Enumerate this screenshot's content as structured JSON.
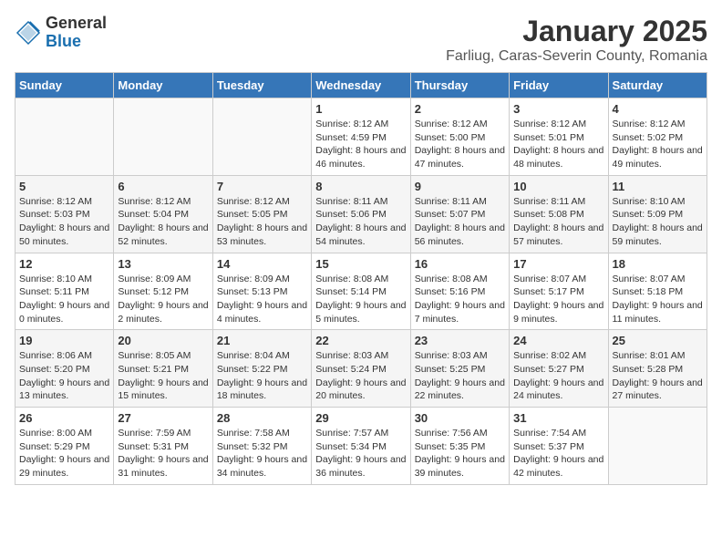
{
  "logo": {
    "general": "General",
    "blue": "Blue"
  },
  "title": "January 2025",
  "subtitle": "Farliug, Caras-Severin County, Romania",
  "days_of_week": [
    "Sunday",
    "Monday",
    "Tuesday",
    "Wednesday",
    "Thursday",
    "Friday",
    "Saturday"
  ],
  "weeks": [
    [
      {
        "day": "",
        "info": ""
      },
      {
        "day": "",
        "info": ""
      },
      {
        "day": "",
        "info": ""
      },
      {
        "day": "1",
        "info": "Sunrise: 8:12 AM\nSunset: 4:59 PM\nDaylight: 8 hours and 46 minutes."
      },
      {
        "day": "2",
        "info": "Sunrise: 8:12 AM\nSunset: 5:00 PM\nDaylight: 8 hours and 47 minutes."
      },
      {
        "day": "3",
        "info": "Sunrise: 8:12 AM\nSunset: 5:01 PM\nDaylight: 8 hours and 48 minutes."
      },
      {
        "day": "4",
        "info": "Sunrise: 8:12 AM\nSunset: 5:02 PM\nDaylight: 8 hours and 49 minutes."
      }
    ],
    [
      {
        "day": "5",
        "info": "Sunrise: 8:12 AM\nSunset: 5:03 PM\nDaylight: 8 hours and 50 minutes."
      },
      {
        "day": "6",
        "info": "Sunrise: 8:12 AM\nSunset: 5:04 PM\nDaylight: 8 hours and 52 minutes."
      },
      {
        "day": "7",
        "info": "Sunrise: 8:12 AM\nSunset: 5:05 PM\nDaylight: 8 hours and 53 minutes."
      },
      {
        "day": "8",
        "info": "Sunrise: 8:11 AM\nSunset: 5:06 PM\nDaylight: 8 hours and 54 minutes."
      },
      {
        "day": "9",
        "info": "Sunrise: 8:11 AM\nSunset: 5:07 PM\nDaylight: 8 hours and 56 minutes."
      },
      {
        "day": "10",
        "info": "Sunrise: 8:11 AM\nSunset: 5:08 PM\nDaylight: 8 hours and 57 minutes."
      },
      {
        "day": "11",
        "info": "Sunrise: 8:10 AM\nSunset: 5:09 PM\nDaylight: 8 hours and 59 minutes."
      }
    ],
    [
      {
        "day": "12",
        "info": "Sunrise: 8:10 AM\nSunset: 5:11 PM\nDaylight: 9 hours and 0 minutes."
      },
      {
        "day": "13",
        "info": "Sunrise: 8:09 AM\nSunset: 5:12 PM\nDaylight: 9 hours and 2 minutes."
      },
      {
        "day": "14",
        "info": "Sunrise: 8:09 AM\nSunset: 5:13 PM\nDaylight: 9 hours and 4 minutes."
      },
      {
        "day": "15",
        "info": "Sunrise: 8:08 AM\nSunset: 5:14 PM\nDaylight: 9 hours and 5 minutes."
      },
      {
        "day": "16",
        "info": "Sunrise: 8:08 AM\nSunset: 5:16 PM\nDaylight: 9 hours and 7 minutes."
      },
      {
        "day": "17",
        "info": "Sunrise: 8:07 AM\nSunset: 5:17 PM\nDaylight: 9 hours and 9 minutes."
      },
      {
        "day": "18",
        "info": "Sunrise: 8:07 AM\nSunset: 5:18 PM\nDaylight: 9 hours and 11 minutes."
      }
    ],
    [
      {
        "day": "19",
        "info": "Sunrise: 8:06 AM\nSunset: 5:20 PM\nDaylight: 9 hours and 13 minutes."
      },
      {
        "day": "20",
        "info": "Sunrise: 8:05 AM\nSunset: 5:21 PM\nDaylight: 9 hours and 15 minutes."
      },
      {
        "day": "21",
        "info": "Sunrise: 8:04 AM\nSunset: 5:22 PM\nDaylight: 9 hours and 18 minutes."
      },
      {
        "day": "22",
        "info": "Sunrise: 8:03 AM\nSunset: 5:24 PM\nDaylight: 9 hours and 20 minutes."
      },
      {
        "day": "23",
        "info": "Sunrise: 8:03 AM\nSunset: 5:25 PM\nDaylight: 9 hours and 22 minutes."
      },
      {
        "day": "24",
        "info": "Sunrise: 8:02 AM\nSunset: 5:27 PM\nDaylight: 9 hours and 24 minutes."
      },
      {
        "day": "25",
        "info": "Sunrise: 8:01 AM\nSunset: 5:28 PM\nDaylight: 9 hours and 27 minutes."
      }
    ],
    [
      {
        "day": "26",
        "info": "Sunrise: 8:00 AM\nSunset: 5:29 PM\nDaylight: 9 hours and 29 minutes."
      },
      {
        "day": "27",
        "info": "Sunrise: 7:59 AM\nSunset: 5:31 PM\nDaylight: 9 hours and 31 minutes."
      },
      {
        "day": "28",
        "info": "Sunrise: 7:58 AM\nSunset: 5:32 PM\nDaylight: 9 hours and 34 minutes."
      },
      {
        "day": "29",
        "info": "Sunrise: 7:57 AM\nSunset: 5:34 PM\nDaylight: 9 hours and 36 minutes."
      },
      {
        "day": "30",
        "info": "Sunrise: 7:56 AM\nSunset: 5:35 PM\nDaylight: 9 hours and 39 minutes."
      },
      {
        "day": "31",
        "info": "Sunrise: 7:54 AM\nSunset: 5:37 PM\nDaylight: 9 hours and 42 minutes."
      },
      {
        "day": "",
        "info": ""
      }
    ]
  ]
}
